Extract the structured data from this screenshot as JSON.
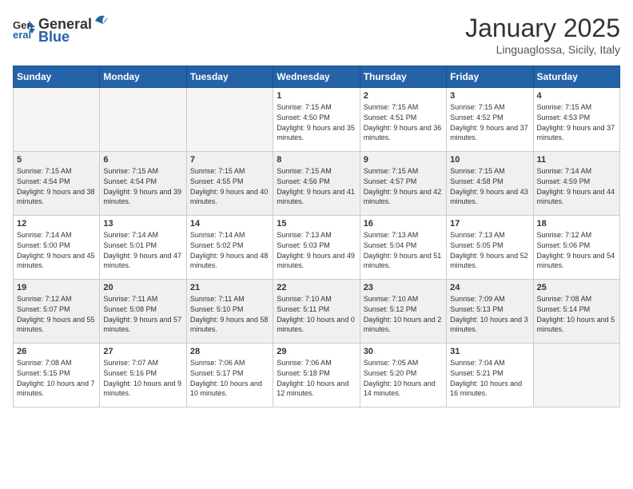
{
  "header": {
    "logo_general": "General",
    "logo_blue": "Blue",
    "month": "January 2025",
    "location": "Linguaglossa, Sicily, Italy"
  },
  "days_of_week": [
    "Sunday",
    "Monday",
    "Tuesday",
    "Wednesday",
    "Thursday",
    "Friday",
    "Saturday"
  ],
  "weeks": [
    {
      "shaded": false,
      "days": [
        {
          "num": "",
          "empty": true
        },
        {
          "num": "",
          "empty": true
        },
        {
          "num": "",
          "empty": true
        },
        {
          "num": "1",
          "sunrise": "7:15 AM",
          "sunset": "4:50 PM",
          "daylight": "9 hours and 35 minutes."
        },
        {
          "num": "2",
          "sunrise": "7:15 AM",
          "sunset": "4:51 PM",
          "daylight": "9 hours and 36 minutes."
        },
        {
          "num": "3",
          "sunrise": "7:15 AM",
          "sunset": "4:52 PM",
          "daylight": "9 hours and 37 minutes."
        },
        {
          "num": "4",
          "sunrise": "7:15 AM",
          "sunset": "4:53 PM",
          "daylight": "9 hours and 37 minutes."
        }
      ]
    },
    {
      "shaded": true,
      "days": [
        {
          "num": "5",
          "sunrise": "7:15 AM",
          "sunset": "4:54 PM",
          "daylight": "9 hours and 38 minutes."
        },
        {
          "num": "6",
          "sunrise": "7:15 AM",
          "sunset": "4:54 PM",
          "daylight": "9 hours and 39 minutes."
        },
        {
          "num": "7",
          "sunrise": "7:15 AM",
          "sunset": "4:55 PM",
          "daylight": "9 hours and 40 minutes."
        },
        {
          "num": "8",
          "sunrise": "7:15 AM",
          "sunset": "4:56 PM",
          "daylight": "9 hours and 41 minutes."
        },
        {
          "num": "9",
          "sunrise": "7:15 AM",
          "sunset": "4:57 PM",
          "daylight": "9 hours and 42 minutes."
        },
        {
          "num": "10",
          "sunrise": "7:15 AM",
          "sunset": "4:58 PM",
          "daylight": "9 hours and 43 minutes."
        },
        {
          "num": "11",
          "sunrise": "7:14 AM",
          "sunset": "4:59 PM",
          "daylight": "9 hours and 44 minutes."
        }
      ]
    },
    {
      "shaded": false,
      "days": [
        {
          "num": "12",
          "sunrise": "7:14 AM",
          "sunset": "5:00 PM",
          "daylight": "9 hours and 45 minutes."
        },
        {
          "num": "13",
          "sunrise": "7:14 AM",
          "sunset": "5:01 PM",
          "daylight": "9 hours and 47 minutes."
        },
        {
          "num": "14",
          "sunrise": "7:14 AM",
          "sunset": "5:02 PM",
          "daylight": "9 hours and 48 minutes."
        },
        {
          "num": "15",
          "sunrise": "7:13 AM",
          "sunset": "5:03 PM",
          "daylight": "9 hours and 49 minutes."
        },
        {
          "num": "16",
          "sunrise": "7:13 AM",
          "sunset": "5:04 PM",
          "daylight": "9 hours and 51 minutes."
        },
        {
          "num": "17",
          "sunrise": "7:13 AM",
          "sunset": "5:05 PM",
          "daylight": "9 hours and 52 minutes."
        },
        {
          "num": "18",
          "sunrise": "7:12 AM",
          "sunset": "5:06 PM",
          "daylight": "9 hours and 54 minutes."
        }
      ]
    },
    {
      "shaded": true,
      "days": [
        {
          "num": "19",
          "sunrise": "7:12 AM",
          "sunset": "5:07 PM",
          "daylight": "9 hours and 55 minutes."
        },
        {
          "num": "20",
          "sunrise": "7:11 AM",
          "sunset": "5:08 PM",
          "daylight": "9 hours and 57 minutes."
        },
        {
          "num": "21",
          "sunrise": "7:11 AM",
          "sunset": "5:10 PM",
          "daylight": "9 hours and 58 minutes."
        },
        {
          "num": "22",
          "sunrise": "7:10 AM",
          "sunset": "5:11 PM",
          "daylight": "10 hours and 0 minutes."
        },
        {
          "num": "23",
          "sunrise": "7:10 AM",
          "sunset": "5:12 PM",
          "daylight": "10 hours and 2 minutes."
        },
        {
          "num": "24",
          "sunrise": "7:09 AM",
          "sunset": "5:13 PM",
          "daylight": "10 hours and 3 minutes."
        },
        {
          "num": "25",
          "sunrise": "7:08 AM",
          "sunset": "5:14 PM",
          "daylight": "10 hours and 5 minutes."
        }
      ]
    },
    {
      "shaded": false,
      "days": [
        {
          "num": "26",
          "sunrise": "7:08 AM",
          "sunset": "5:15 PM",
          "daylight": "10 hours and 7 minutes."
        },
        {
          "num": "27",
          "sunrise": "7:07 AM",
          "sunset": "5:16 PM",
          "daylight": "10 hours and 9 minutes."
        },
        {
          "num": "28",
          "sunrise": "7:06 AM",
          "sunset": "5:17 PM",
          "daylight": "10 hours and 10 minutes."
        },
        {
          "num": "29",
          "sunrise": "7:06 AM",
          "sunset": "5:18 PM",
          "daylight": "10 hours and 12 minutes."
        },
        {
          "num": "30",
          "sunrise": "7:05 AM",
          "sunset": "5:20 PM",
          "daylight": "10 hours and 14 minutes."
        },
        {
          "num": "31",
          "sunrise": "7:04 AM",
          "sunset": "5:21 PM",
          "daylight": "10 hours and 16 minutes."
        },
        {
          "num": "",
          "empty": true
        }
      ]
    }
  ]
}
